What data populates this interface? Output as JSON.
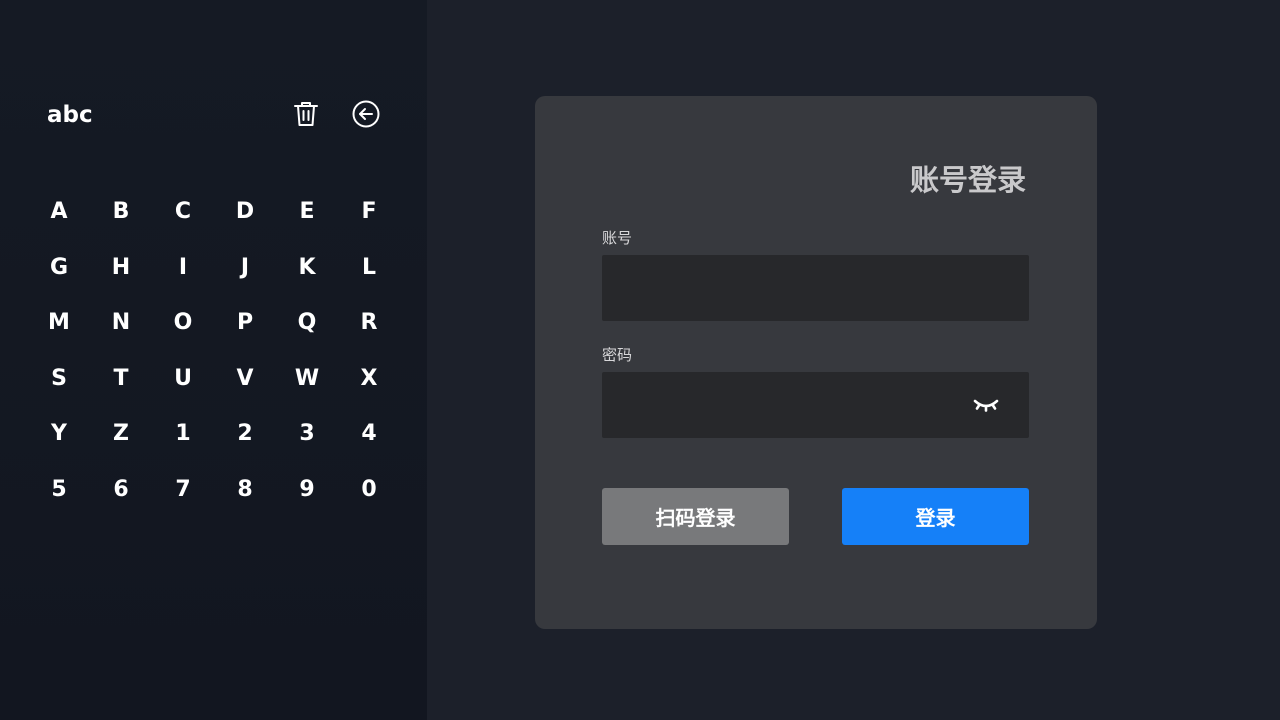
{
  "keyboard": {
    "mode_label": "abc",
    "delete_icon": "trash-icon",
    "back_icon": "circle-arrow-left-icon",
    "keys": [
      "A",
      "B",
      "C",
      "D",
      "E",
      "F",
      "G",
      "H",
      "I",
      "J",
      "K",
      "L",
      "M",
      "N",
      "O",
      "P",
      "Q",
      "R",
      "S",
      "T",
      "U",
      "V",
      "W",
      "X",
      "Y",
      "Z",
      "1",
      "2",
      "3",
      "4",
      "5",
      "6",
      "7",
      "8",
      "9",
      "0"
    ]
  },
  "login": {
    "title": "账号登录",
    "account_label": "账号",
    "account_value": "",
    "password_label": "密码",
    "password_value": "",
    "password_toggle_icon": "eye-closed-icon",
    "scan_button": "扫码登录",
    "login_button": "登录"
  },
  "colors": {
    "background": "#1c202a",
    "keyboard_panel": "#141923",
    "card": "#37393e",
    "field": "#27282b",
    "scan_button": "#78797b",
    "login_button": "#1580f8"
  }
}
